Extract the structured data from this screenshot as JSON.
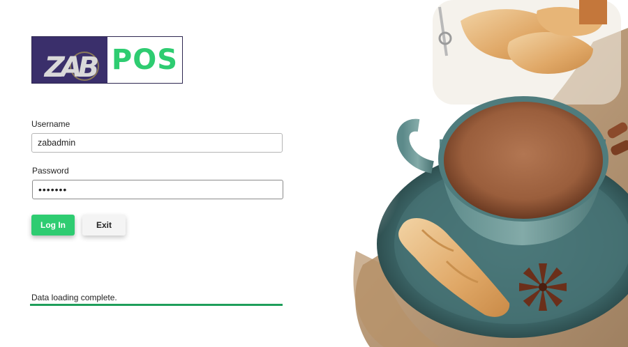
{
  "app": {
    "logo_text": "POS",
    "logo_initials": "ZAB"
  },
  "login": {
    "username_label": "Username",
    "username_value": "zabadmin",
    "password_label": "Password",
    "password_value": "•••••••",
    "login_label": "Log In",
    "exit_label": "Exit"
  },
  "status": {
    "message": "Data loading complete.",
    "progress": 1.0
  },
  "colors": {
    "accent": "#2ecc71",
    "logo_bg": "#3a2f6b",
    "progress": "#1e9e5a"
  }
}
